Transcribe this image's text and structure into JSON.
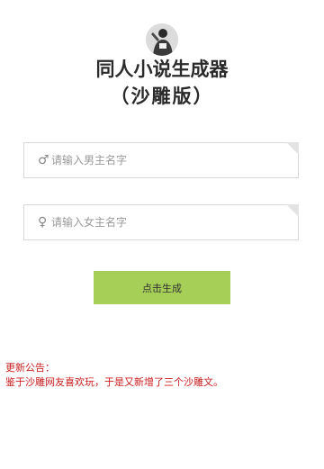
{
  "header": {
    "title_line1": "同人小说生成器",
    "title_line2": "（沙雕版）"
  },
  "form": {
    "male_icon": "♂",
    "male_placeholder": "请输入男主名字",
    "male_value": "",
    "female_icon": "♀",
    "female_placeholder": "请输入女主名字",
    "female_value": "",
    "generate_label": "点击生成"
  },
  "notice": {
    "heading": "更新公告：",
    "body": "鉴于沙雕网友喜欢玩，于是又新增了三个沙雕文。"
  },
  "colors": {
    "accent": "#a5cf56",
    "notice": "#c81d1d",
    "border": "#d9d9d9"
  },
  "icons": {
    "avatar": "avatar-photo",
    "male": "male-symbol-icon",
    "female": "female-symbol-icon"
  }
}
